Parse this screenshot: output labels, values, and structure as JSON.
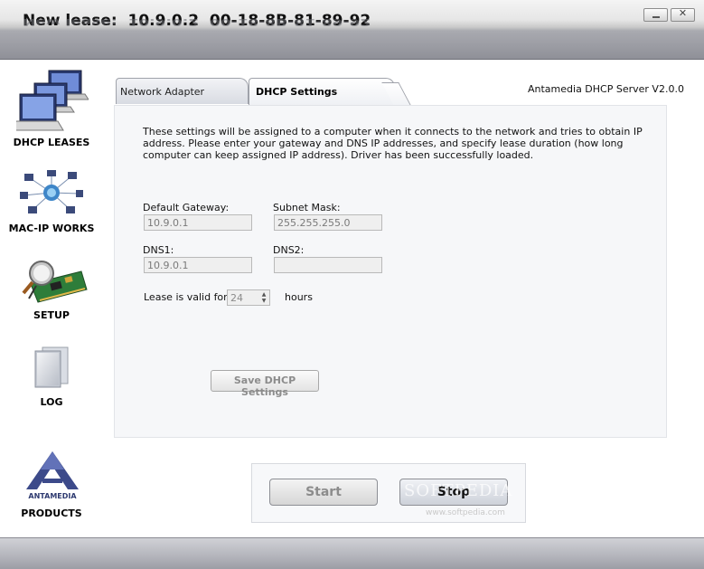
{
  "title": {
    "lease_label": "New lease:",
    "ip": "10.9.0.2",
    "mac": "00-18-8B-81-89-92"
  },
  "window_controls": {
    "minimize": "minimize",
    "close": "close"
  },
  "sidebar": {
    "items": [
      {
        "label": "DHCP LEASES",
        "icon": "computers-icon"
      },
      {
        "label": "MAC-IP WORKS",
        "icon": "network-icon"
      },
      {
        "label": "SETUP",
        "icon": "network-card-icon"
      },
      {
        "label": "LOG",
        "icon": "log-pages-icon"
      },
      {
        "label": "PRODUCTS",
        "icon": "antamedia-logo",
        "logo_text": "ANTAMEDIA"
      }
    ]
  },
  "tabs": [
    {
      "label": "Network Adapter",
      "active": false
    },
    {
      "label": "DHCP Settings",
      "active": true
    }
  ],
  "version": "Antamedia DHCP Server V2.0.0",
  "description": "These settings will be assigned to a computer when it connects to the network and tries to obtain IP address. Please enter your gateway and DNS IP addresses, and specify lease duration (how long computer can keep assigned IP address). Driver has been successfully loaded.",
  "fields": {
    "gateway": {
      "label": "Default Gateway:",
      "value": "10.9.0.1"
    },
    "subnet": {
      "label": "Subnet Mask:",
      "value": "255.255.255.0"
    },
    "dns1": {
      "label": "DNS1:",
      "value": "10.9.0.1"
    },
    "dns2": {
      "label": "DNS2:",
      "value": ""
    }
  },
  "lease": {
    "label": "Lease is valid for",
    "value": "24",
    "unit": "hours"
  },
  "buttons": {
    "save": "Save DHCP Settings",
    "start": "Start",
    "stop": "Stop"
  },
  "watermark": {
    "text": "SOFTPEDIA",
    "sub": "www.softpedia.com"
  },
  "colors": {
    "titlebar": "#9c9da4",
    "panel": "#f6f7f9",
    "disabled_text": "#8c8c8c"
  }
}
